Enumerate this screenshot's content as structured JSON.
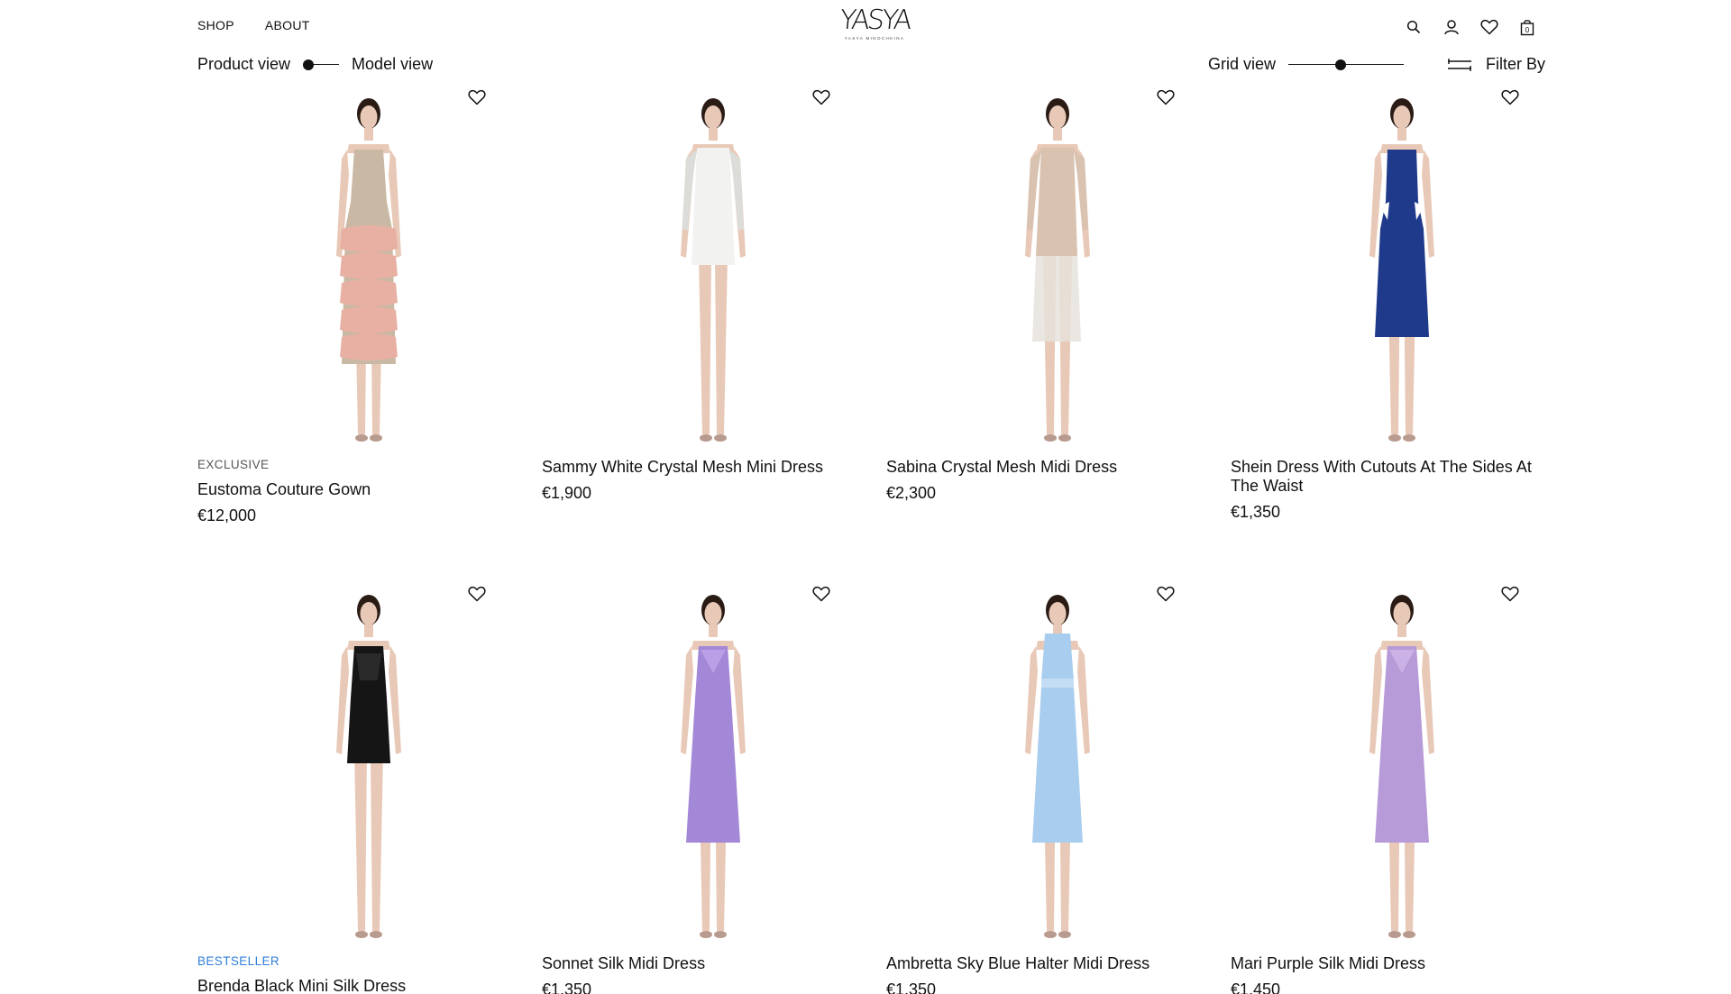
{
  "header": {
    "nav": [
      {
        "label": "SHOP"
      },
      {
        "label": "ABOUT"
      }
    ],
    "logo": {
      "mark": "YASYA",
      "sub": "YASYA MINOCHKINA"
    }
  },
  "toolbar": {
    "product_view_label": "Product view",
    "model_view_label": "Model view",
    "grid_view_label": "Grid view",
    "grid_view_level": 0.45,
    "filter_label": "Filter By"
  },
  "products": [
    {
      "tag": "EXCLUSIVE",
      "tag_color": "#555555",
      "name": "Eustoma Couture Gown",
      "price": "€12,000",
      "dress_color": "#e7b0a3",
      "dress_accent": "#c9b9a4",
      "style": "gown"
    },
    {
      "tag": "",
      "name": "Sammy White Crystal Mesh Mini Dress",
      "price": "€1,900",
      "dress_color": "#f2f2f0",
      "dress_accent": "#dcdcd8",
      "style": "mini-sleeve"
    },
    {
      "tag": "",
      "name": "Sabina Crystal Mesh Midi Dress",
      "price": "€2,300",
      "dress_color": "#d9c2b0",
      "dress_accent": "#e6e2dc",
      "style": "midi-sleeve"
    },
    {
      "tag": "",
      "name": "Shein Dress With Cutouts At The Sides At The Waist",
      "price": "€1,350",
      "dress_color": "#1f3a8a",
      "dress_accent": "#2d4ba5",
      "style": "midi-cutout"
    },
    {
      "tag": "BESTSELLER",
      "tag_color": "#2f7fd8",
      "name": "Brenda Black Mini Silk Dress",
      "price": "",
      "dress_color": "#151515",
      "dress_accent": "#2a2a2a",
      "style": "mini-slip"
    },
    {
      "tag": "",
      "name": "Sonnet Silk Midi Dress",
      "price": "€1,350",
      "dress_color": "#a488d8",
      "dress_accent": "#b9a0e6",
      "style": "midi-slip"
    },
    {
      "tag": "",
      "name": "Ambretta Sky Blue Halter Midi Dress",
      "price": "€1,350",
      "dress_color": "#a9cdef",
      "dress_accent": "#c4ddf5",
      "style": "midi-halter"
    },
    {
      "tag": "",
      "name": "Mari Purple Silk Midi Dress",
      "price": "€1,450",
      "dress_color": "#b79ad8",
      "dress_accent": "#cbb2e6",
      "style": "midi-slip"
    }
  ]
}
